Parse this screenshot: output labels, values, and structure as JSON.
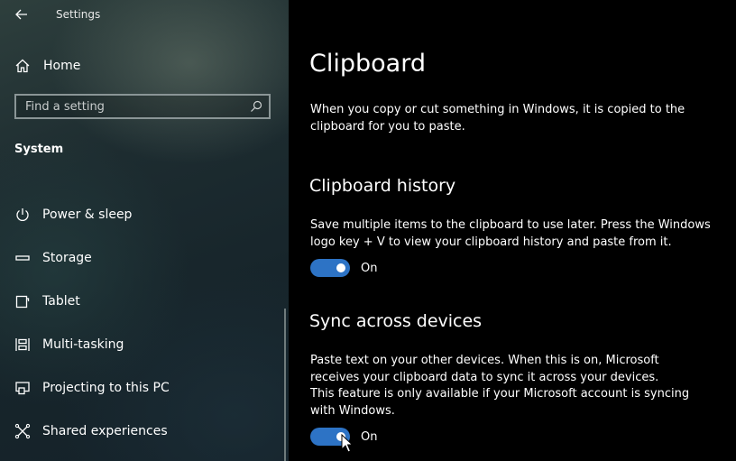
{
  "window": {
    "title": "Settings"
  },
  "sidebar": {
    "home_label": "Home",
    "search_placeholder": "Find a setting",
    "section_title": "System",
    "items": [
      {
        "label": "Power & sleep",
        "icon": "power-icon"
      },
      {
        "label": "Storage",
        "icon": "storage-icon"
      },
      {
        "label": "Tablet",
        "icon": "tablet-icon"
      },
      {
        "label": "Multi-tasking",
        "icon": "multitasking-icon"
      },
      {
        "label": "Projecting to this PC",
        "icon": "projecting-icon"
      },
      {
        "label": "Shared experiences",
        "icon": "shared-experiences-icon"
      }
    ]
  },
  "main": {
    "title": "Clipboard",
    "intro": "When you copy or cut something in Windows, it is copied to the clipboard for you to paste.",
    "history": {
      "heading": "Clipboard history",
      "description": "Save multiple items to the clipboard to use later. Press the Windows logo key + V to view your clipboard history and paste from it.",
      "toggle_state": "On"
    },
    "sync": {
      "heading": "Sync across devices",
      "description": "Paste text on your other devices. When this is on, Microsoft receives your clipboard data to sync it across your devices.",
      "note": "This feature is only available if your Microsoft account is syncing with Windows.",
      "toggle_state": "On"
    }
  },
  "colors": {
    "accent": "#2d73c5",
    "background": "#000000",
    "text": "#ffffff"
  }
}
